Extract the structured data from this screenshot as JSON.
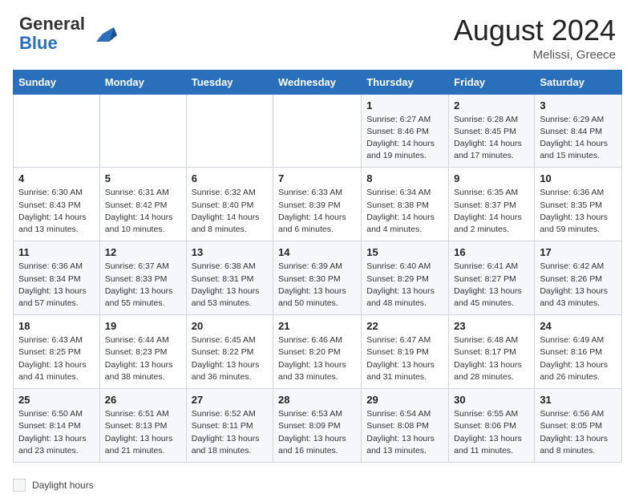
{
  "header": {
    "logo_general": "General",
    "logo_blue": "Blue",
    "month_year": "August 2024",
    "location": "Melissi, Greece"
  },
  "footer": {
    "daylight_label": "Daylight hours"
  },
  "days_of_week": [
    "Sunday",
    "Monday",
    "Tuesday",
    "Wednesday",
    "Thursday",
    "Friday",
    "Saturday"
  ],
  "weeks": [
    [
      {
        "day": "",
        "info": ""
      },
      {
        "day": "",
        "info": ""
      },
      {
        "day": "",
        "info": ""
      },
      {
        "day": "",
        "info": ""
      },
      {
        "day": "1",
        "info": "Sunrise: 6:27 AM\nSunset: 8:46 PM\nDaylight: 14 hours\nand 19 minutes."
      },
      {
        "day": "2",
        "info": "Sunrise: 6:28 AM\nSunset: 8:45 PM\nDaylight: 14 hours\nand 17 minutes."
      },
      {
        "day": "3",
        "info": "Sunrise: 6:29 AM\nSunset: 8:44 PM\nDaylight: 14 hours\nand 15 minutes."
      }
    ],
    [
      {
        "day": "4",
        "info": "Sunrise: 6:30 AM\nSunset: 8:43 PM\nDaylight: 14 hours\nand 13 minutes."
      },
      {
        "day": "5",
        "info": "Sunrise: 6:31 AM\nSunset: 8:42 PM\nDaylight: 14 hours\nand 10 minutes."
      },
      {
        "day": "6",
        "info": "Sunrise: 6:32 AM\nSunset: 8:40 PM\nDaylight: 14 hours\nand 8 minutes."
      },
      {
        "day": "7",
        "info": "Sunrise: 6:33 AM\nSunset: 8:39 PM\nDaylight: 14 hours\nand 6 minutes."
      },
      {
        "day": "8",
        "info": "Sunrise: 6:34 AM\nSunset: 8:38 PM\nDaylight: 14 hours\nand 4 minutes."
      },
      {
        "day": "9",
        "info": "Sunrise: 6:35 AM\nSunset: 8:37 PM\nDaylight: 14 hours\nand 2 minutes."
      },
      {
        "day": "10",
        "info": "Sunrise: 6:36 AM\nSunset: 8:35 PM\nDaylight: 13 hours\nand 59 minutes."
      }
    ],
    [
      {
        "day": "11",
        "info": "Sunrise: 6:36 AM\nSunset: 8:34 PM\nDaylight: 13 hours\nand 57 minutes."
      },
      {
        "day": "12",
        "info": "Sunrise: 6:37 AM\nSunset: 8:33 PM\nDaylight: 13 hours\nand 55 minutes."
      },
      {
        "day": "13",
        "info": "Sunrise: 6:38 AM\nSunset: 8:31 PM\nDaylight: 13 hours\nand 53 minutes."
      },
      {
        "day": "14",
        "info": "Sunrise: 6:39 AM\nSunset: 8:30 PM\nDaylight: 13 hours\nand 50 minutes."
      },
      {
        "day": "15",
        "info": "Sunrise: 6:40 AM\nSunset: 8:29 PM\nDaylight: 13 hours\nand 48 minutes."
      },
      {
        "day": "16",
        "info": "Sunrise: 6:41 AM\nSunset: 8:27 PM\nDaylight: 13 hours\nand 45 minutes."
      },
      {
        "day": "17",
        "info": "Sunrise: 6:42 AM\nSunset: 8:26 PM\nDaylight: 13 hours\nand 43 minutes."
      }
    ],
    [
      {
        "day": "18",
        "info": "Sunrise: 6:43 AM\nSunset: 8:25 PM\nDaylight: 13 hours\nand 41 minutes."
      },
      {
        "day": "19",
        "info": "Sunrise: 6:44 AM\nSunset: 8:23 PM\nDaylight: 13 hours\nand 38 minutes."
      },
      {
        "day": "20",
        "info": "Sunrise: 6:45 AM\nSunset: 8:22 PM\nDaylight: 13 hours\nand 36 minutes."
      },
      {
        "day": "21",
        "info": "Sunrise: 6:46 AM\nSunset: 8:20 PM\nDaylight: 13 hours\nand 33 minutes."
      },
      {
        "day": "22",
        "info": "Sunrise: 6:47 AM\nSunset: 8:19 PM\nDaylight: 13 hours\nand 31 minutes."
      },
      {
        "day": "23",
        "info": "Sunrise: 6:48 AM\nSunset: 8:17 PM\nDaylight: 13 hours\nand 28 minutes."
      },
      {
        "day": "24",
        "info": "Sunrise: 6:49 AM\nSunset: 8:16 PM\nDaylight: 13 hours\nand 26 minutes."
      }
    ],
    [
      {
        "day": "25",
        "info": "Sunrise: 6:50 AM\nSunset: 8:14 PM\nDaylight: 13 hours\nand 23 minutes."
      },
      {
        "day": "26",
        "info": "Sunrise: 6:51 AM\nSunset: 8:13 PM\nDaylight: 13 hours\nand 21 minutes."
      },
      {
        "day": "27",
        "info": "Sunrise: 6:52 AM\nSunset: 8:11 PM\nDaylight: 13 hours\nand 18 minutes."
      },
      {
        "day": "28",
        "info": "Sunrise: 6:53 AM\nSunset: 8:09 PM\nDaylight: 13 hours\nand 16 minutes."
      },
      {
        "day": "29",
        "info": "Sunrise: 6:54 AM\nSunset: 8:08 PM\nDaylight: 13 hours\nand 13 minutes."
      },
      {
        "day": "30",
        "info": "Sunrise: 6:55 AM\nSunset: 8:06 PM\nDaylight: 13 hours\nand 11 minutes."
      },
      {
        "day": "31",
        "info": "Sunrise: 6:56 AM\nSunset: 8:05 PM\nDaylight: 13 hours\nand 8 minutes."
      }
    ]
  ]
}
